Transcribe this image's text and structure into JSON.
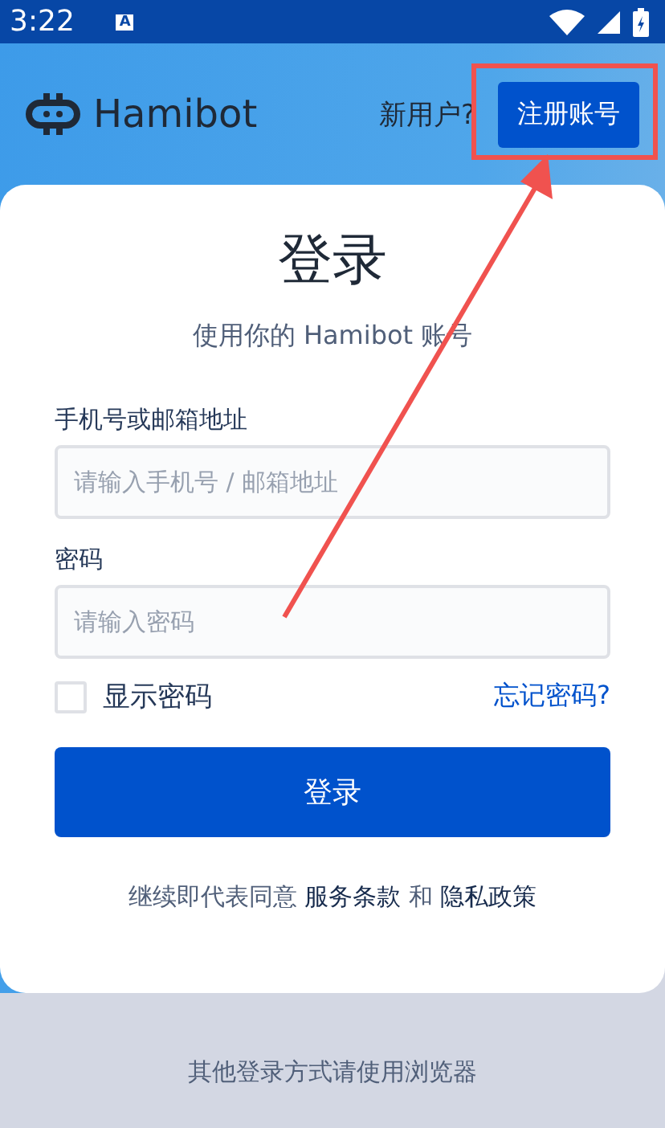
{
  "status_bar": {
    "time": "3:22",
    "notification": "A"
  },
  "header": {
    "logo_text": "Hamibot",
    "prompt": "新用户?",
    "register_button": "注册账号"
  },
  "card": {
    "title": "登录",
    "subtitle": "使用你的 Hamibot 账号",
    "fields": [
      {
        "label": "手机号或邮箱地址",
        "placeholder": "请输入手机号 / 邮箱地址"
      },
      {
        "label": "密码",
        "placeholder": "请输入密码"
      }
    ],
    "show_password": {
      "label": "显示密码",
      "checked": false
    },
    "forgot_link": "忘记密码?",
    "login_button": "登录",
    "terms": {
      "prefix": "继续即代表同意",
      "terms_link": "服务条款",
      "conjunction": "和",
      "privacy_link": "隐私政策"
    }
  },
  "footer": "其他登录方式请使用浏览器"
}
